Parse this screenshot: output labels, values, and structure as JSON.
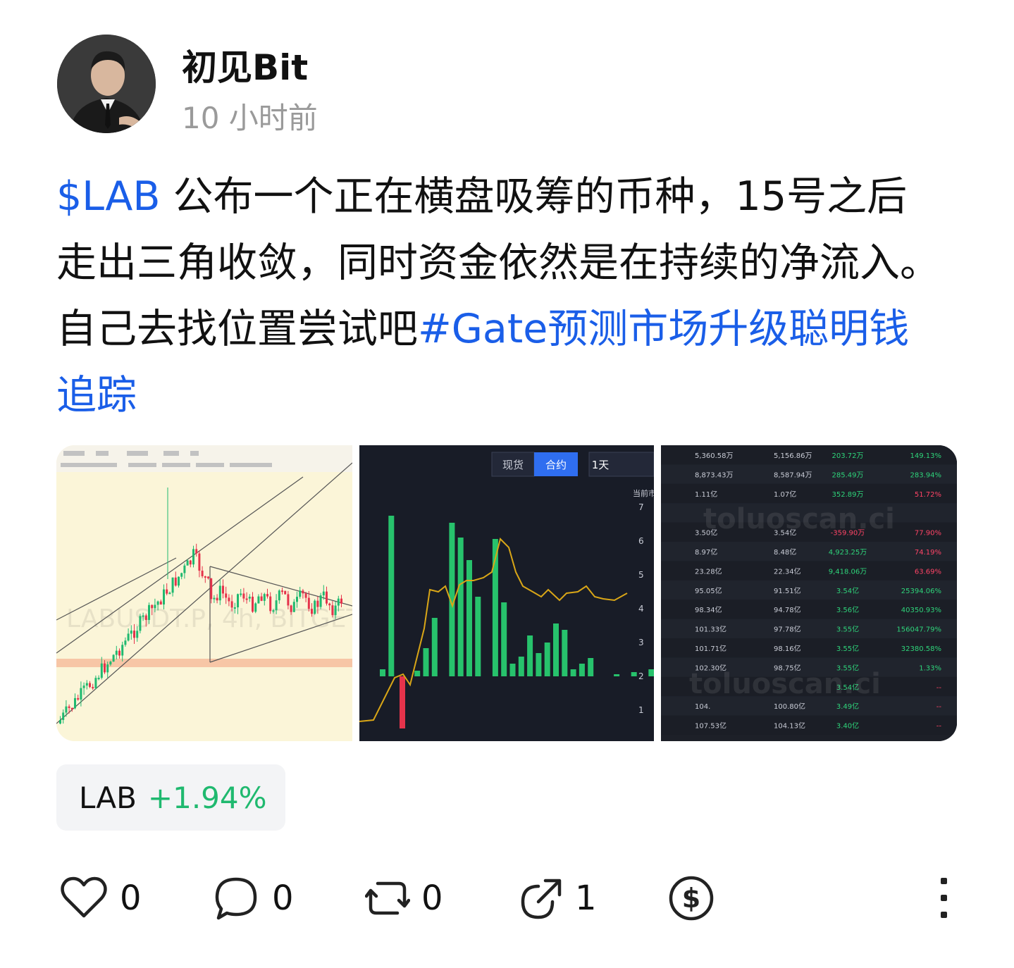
{
  "author": {
    "name": "初见Bit",
    "time": "10 小时前"
  },
  "post": {
    "cashtag": "$LAB",
    "text": " 公布一个正在横盘吸筹的币种，15号之后走出三角收敛，同时资金依然是在持续的净流入。自己去找位置尝试吧",
    "hashtag": "#Gate预测市场升级聪明钱追踪"
  },
  "images": {
    "chart1": {
      "overlay": "LABUSDT.P, 4h, BITGET"
    },
    "chart2": {
      "tabs": [
        "现货",
        "合约",
        "1天"
      ],
      "active_tab": "合约",
      "axis_title": "当前市",
      "y_ticks": [
        "7",
        "6",
        "5",
        "4",
        "3",
        "2",
        "1"
      ]
    },
    "table": {
      "rows": [
        [
          "5,360.58万",
          "5,156.86万",
          "203.72万",
          "149.13%"
        ],
        [
          "8,873.43万",
          "8,587.94万",
          "285.49万",
          "283.94%"
        ],
        [
          "1.11亿",
          "1.07亿",
          "352.89万",
          "51.72%"
        ],
        [
          "",
          "",
          "",
          ""
        ],
        [
          "3.50亿",
          "3.54亿",
          "-359.90万",
          "77.90%"
        ],
        [
          "8.97亿",
          "8.48亿",
          "4,923.25万",
          "74.19%"
        ],
        [
          "23.28亿",
          "22.34亿",
          "9,418.06万",
          "63.69%"
        ],
        [
          "95.05亿",
          "91.51亿",
          "3.54亿",
          "25394.06%"
        ],
        [
          "98.34亿",
          "94.78亿",
          "3.56亿",
          "40350.93%"
        ],
        [
          "101.33亿",
          "97.78亿",
          "3.55亿",
          "156047.79%"
        ],
        [
          "101.71亿",
          "98.16亿",
          "3.55亿",
          "32380.58%"
        ],
        [
          "102.30亿",
          "98.75亿",
          "3.55亿",
          "1.33%"
        ],
        [
          "",
          "",
          "3.54亿",
          "--"
        ],
        [
          "104.",
          "100.80亿",
          "3.49亿",
          "--"
        ],
        [
          "107.53亿",
          "104.13亿",
          "3.40亿",
          "--"
        ]
      ]
    }
  },
  "ticker": {
    "symbol": "LAB",
    "change": "+1.94%"
  },
  "actions": {
    "likes": "0",
    "comments": "0",
    "reposts": "0",
    "shares": "1"
  },
  "colors": {
    "link": "#1a5ee8",
    "up": "#1fb96f",
    "down": "#e5334b"
  }
}
